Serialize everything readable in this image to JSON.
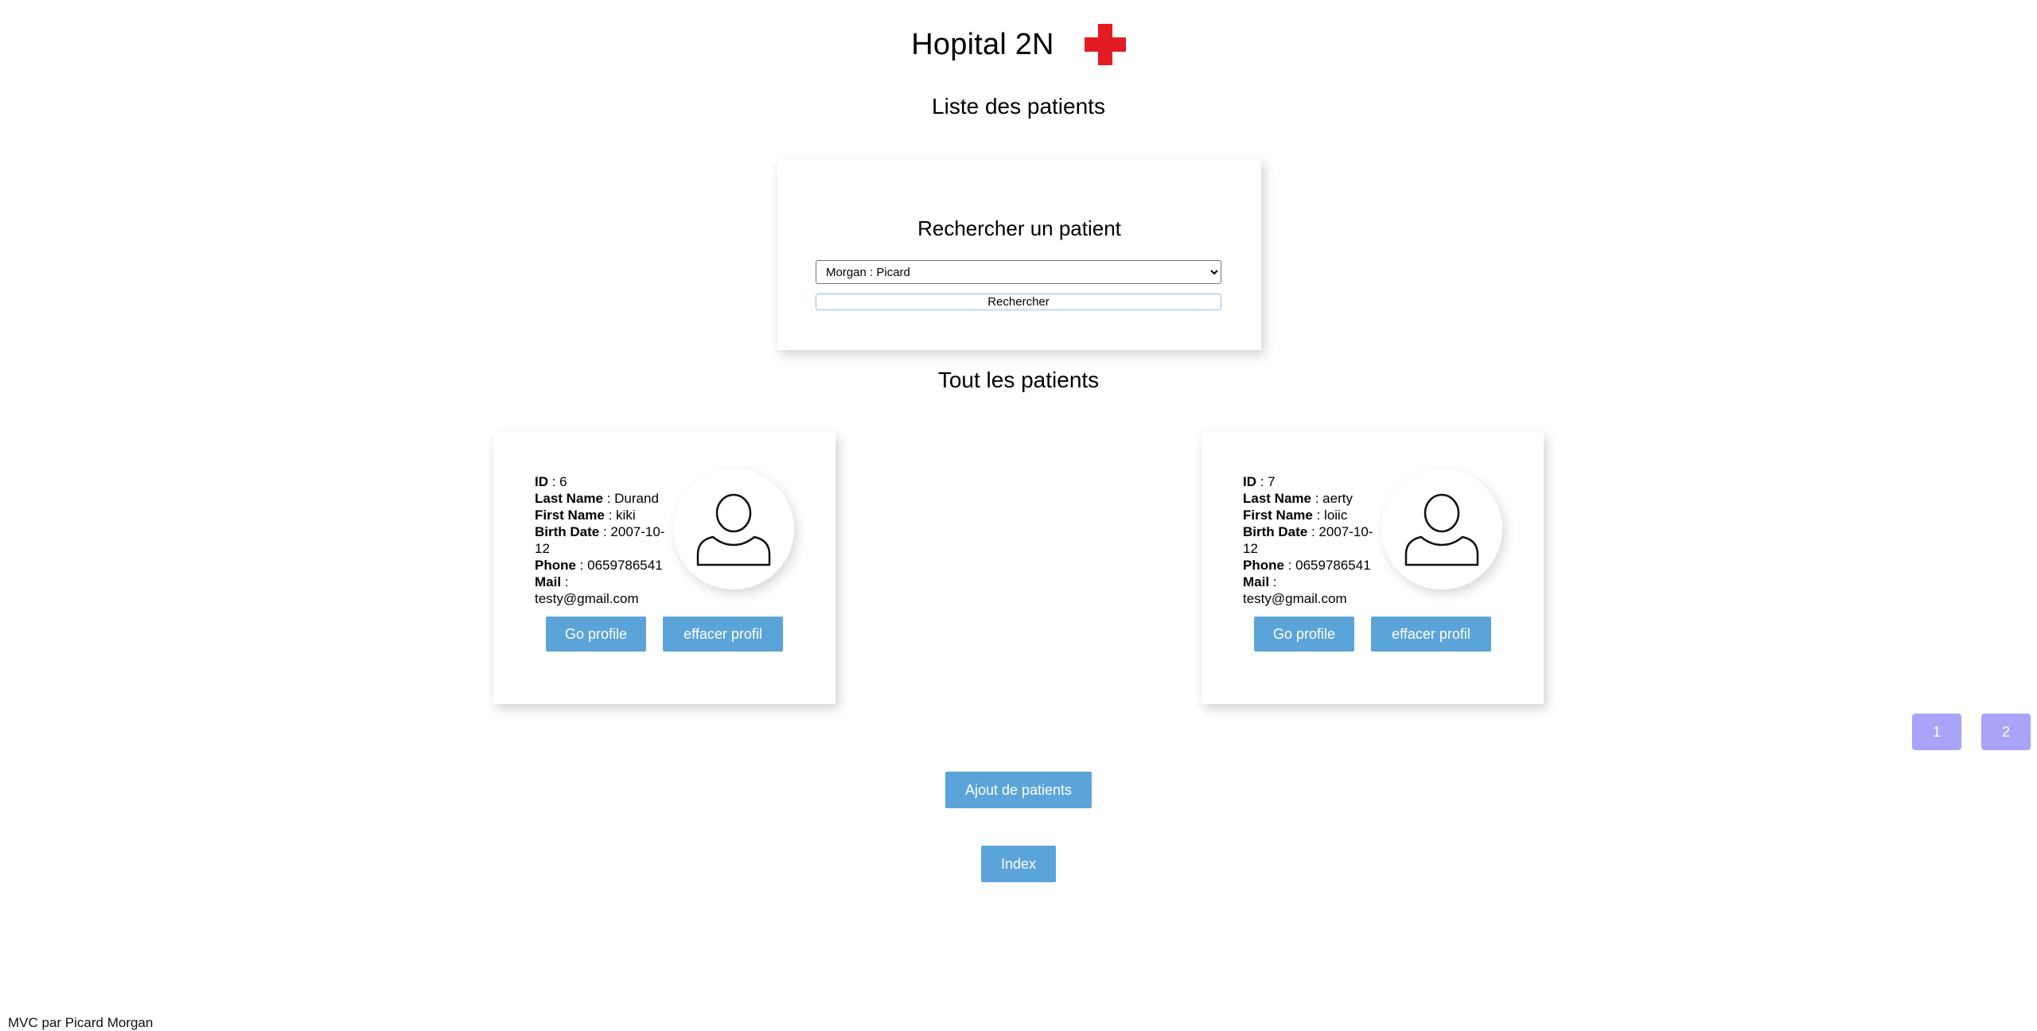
{
  "header": {
    "title": "Hopital 2N",
    "logo_icon": "red-cross-icon",
    "logo_color": "#e31b23"
  },
  "page_title": "Liste des patients",
  "search": {
    "title": "Rechercher un patient",
    "selected": "Morgan : Picard",
    "button_label": "Rechercher"
  },
  "all_patients_title": "Tout les patients",
  "labels": {
    "id": "ID",
    "last_name": "Last Name",
    "first_name": "First Name",
    "birth_date": "Birth Date",
    "phone": "Phone",
    "mail": "Mail",
    "separator": " : "
  },
  "patients": [
    {
      "id": "6",
      "last_name": "Durand",
      "first_name": "kiki",
      "birth_date": "2007-10-12",
      "phone": "0659786541",
      "mail": "testy@gmail.com",
      "go_label": "Go profile",
      "delete_label": "effacer profil"
    },
    {
      "id": "7",
      "last_name": "aerty",
      "first_name": "loiic",
      "birth_date": "2007-10-12",
      "phone": "0659786541",
      "mail": "testy@gmail.com",
      "go_label": "Go profile",
      "delete_label": "effacer profil"
    }
  ],
  "pagination": {
    "pages": [
      "1",
      "2"
    ]
  },
  "actions": {
    "add_label": "Ajout de patients",
    "index_label": "Index"
  },
  "footer": {
    "text": "MVC par Picard Morgan"
  },
  "colors": {
    "primary_button": "#5ba4d9",
    "pagination_button": "#a8a4f7"
  }
}
